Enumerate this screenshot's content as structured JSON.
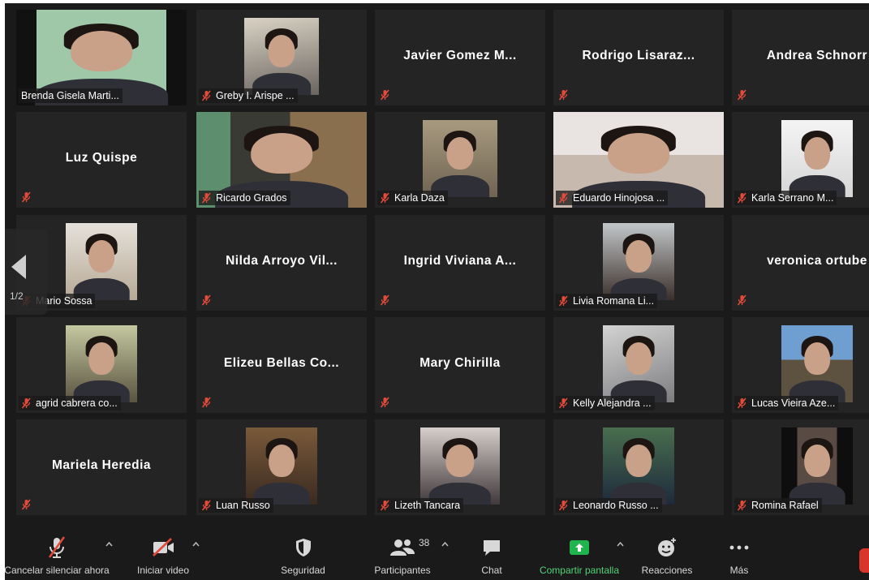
{
  "colors": {
    "active_border": "#d7e36a",
    "tile_bg": "#242424",
    "mic_muted": "#e24a3a",
    "share_green": "#1fb44d",
    "end_red": "#d9362b"
  },
  "participants": [
    {
      "name": "Brenda Gisela Marti...",
      "video": true,
      "active": true
    },
    {
      "name": "Greby I. Arispe ...",
      "video": true
    },
    {
      "name": "Javier Gomez M...",
      "video": false
    },
    {
      "name": "Rodrigo  Lisaraz...",
      "video": false
    },
    {
      "name": "Andrea Schnorr",
      "video": false
    },
    {
      "name": "Luz Quispe",
      "video": false
    },
    {
      "name": "Ricardo Grados",
      "video": true
    },
    {
      "name": "Karla Daza",
      "video": true
    },
    {
      "name": "Eduardo Hinojosa ...",
      "video": true
    },
    {
      "name": "Karla Serrano M...",
      "video": true
    },
    {
      "name": "Mario Sossa",
      "video": true
    },
    {
      "name": "Nilda Arroyo Vil...",
      "video": false
    },
    {
      "name": "Ingrid Viviana A...",
      "video": false
    },
    {
      "name": "Livia Romana Li...",
      "video": true
    },
    {
      "name": "veronica ortube",
      "video": false
    },
    {
      "name": "agrid cabrera co...",
      "video": true
    },
    {
      "name": "Elizeu Bellas Co...",
      "video": false
    },
    {
      "name": "Mary Chirilla",
      "video": false
    },
    {
      "name": "Kelly Alejandra ...",
      "video": true
    },
    {
      "name": "Lucas Vieira Aze...",
      "video": true
    },
    {
      "name": "Mariela Heredia",
      "video": false
    },
    {
      "name": "Luan Russo",
      "video": true
    },
    {
      "name": "Lizeth Tancara",
      "video": true
    },
    {
      "name": "Leonardo Russo ...",
      "video": true
    },
    {
      "name": "Romina Rafael",
      "video": true
    }
  ],
  "pagination": {
    "label": "1/2"
  },
  "toolbar": {
    "unmute": "Cancelar silenciar ahora",
    "start_video": "Iniciar video",
    "security": "Seguridad",
    "participants": "Participantes",
    "participant_count": "38",
    "chat": "Chat",
    "share_screen": "Compartir pantalla",
    "reactions": "Reacciones",
    "more": "Más"
  }
}
